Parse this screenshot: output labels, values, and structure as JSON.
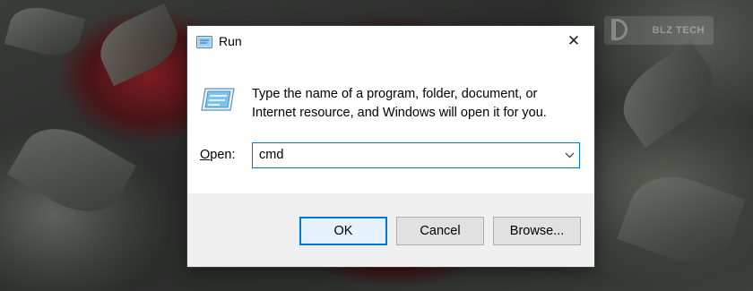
{
  "watermark": {
    "text": "BLZ TECH"
  },
  "dialog": {
    "title": "Run",
    "close_glyph": "✕",
    "description_line1": "Type the name of a program, folder, document, or",
    "description_line2": "Internet resource, and Windows will open it for you.",
    "open_label": "Open:",
    "open_value": "cmd",
    "buttons": {
      "ok": "OK",
      "cancel": "Cancel",
      "browse": "Browse..."
    }
  },
  "colors": {
    "accent": "#0078d7",
    "button_face": "#e1e1e1",
    "footer": "#f0f0f0"
  },
  "icons": {
    "title": "run-icon",
    "main": "run-icon",
    "close": "close-icon",
    "dropdown": "chevron-down-icon"
  }
}
